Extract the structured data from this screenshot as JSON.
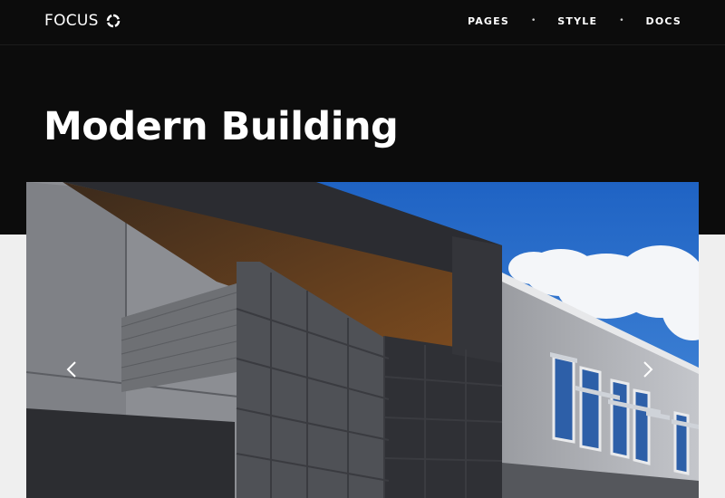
{
  "header": {
    "logo_text": "FOCUS",
    "logo_icon": "circle-ring-icon",
    "nav": [
      {
        "label": "PAGES"
      },
      {
        "label": "STYLE"
      },
      {
        "label": "DOCS"
      }
    ],
    "separator": "•"
  },
  "hero": {
    "title": "Modern Building"
  },
  "slider": {
    "image_subject": "modern building",
    "prev_icon": "chevron-left-icon",
    "next_icon": "chevron-right-icon"
  },
  "colors": {
    "header_bg": "#0c0c0c",
    "page_bg": "#efefef",
    "text": "#ffffff",
    "sky": "#2f72c9"
  }
}
